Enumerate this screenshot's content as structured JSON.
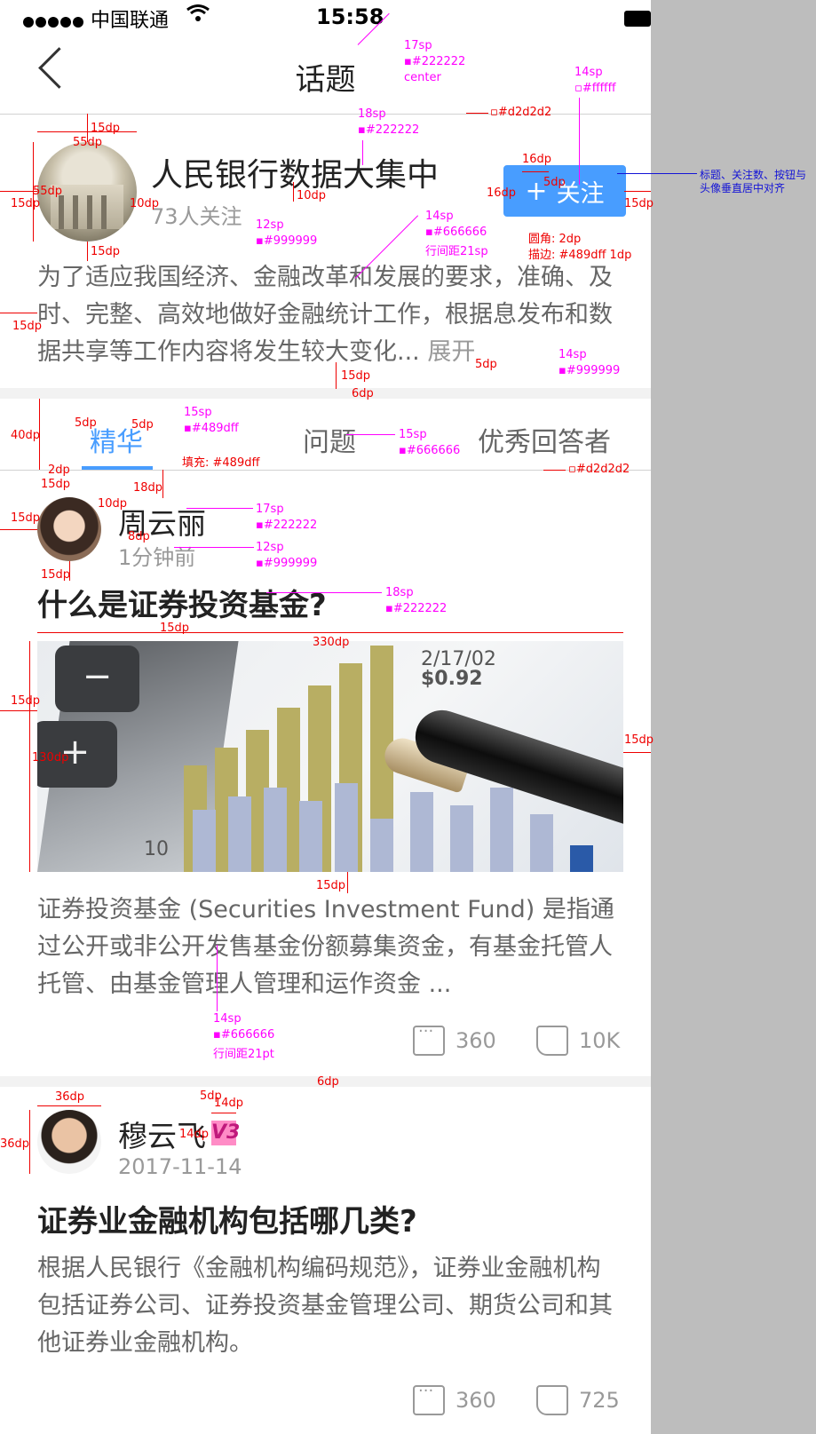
{
  "status_bar": {
    "carrier": "中国联通",
    "time": "15:58"
  },
  "nav": {
    "title": "话题"
  },
  "topic": {
    "title": "人民银行数据大集中",
    "follows": "73人关注",
    "follow_button": "关注",
    "description": "为了适应我国经济、金融改革和发展的要求，准确、及时、完整、高效地做好金融统计工作，根据息发布和数据共享等工作内容将发生较大变化...",
    "expand_label": "展开"
  },
  "tabs": [
    {
      "label": "精华",
      "active": true
    },
    {
      "label": "问题"
    },
    {
      "label": "优秀回答者"
    }
  ],
  "posts": [
    {
      "author": "周云丽",
      "time": "1分钟前",
      "title": "什么是证券投资基金?",
      "image_text": [
        "2/17/02",
        "$0.92",
        "10"
      ],
      "body": "证券投资基金 (Securities Investment Fund) 是指通过公开或非公开发售基金份额募集资金，有基金托管人托管、由基金管理人管理和运作资金 ...",
      "comments": "360",
      "likes": "10K"
    },
    {
      "author": "穆云飞",
      "badge": "V3",
      "time": "2017-11-14",
      "title": "证券业金融机构包括哪几类?",
      "body": "根据人民银行《金融机构编码规范》，证券业金融机构包括证券公司、证券投资基金管理公司、期货公司和其他证券业金融机构。",
      "comments": "360",
      "likes": "725"
    }
  ],
  "annotations": {
    "nav_title": [
      "17sp",
      "#222222",
      "center"
    ],
    "divider": "#d2d2d2",
    "topic_title": [
      "18sp",
      "#222222"
    ],
    "follow_text": [
      "14sp",
      "#ffffff"
    ],
    "align_note": "标题、关注数、按钮与头像垂直居中对齐",
    "follows": [
      "12sp",
      "#999999"
    ],
    "desc": [
      "14sp",
      "#666666",
      "行间距21sp"
    ],
    "button_radius": "圆角: 2dp",
    "button_stroke": "描边: #489dff 1dp",
    "expand": [
      "14sp",
      "#999999"
    ],
    "tab_active": [
      "15sp",
      "#489dff"
    ],
    "tab_inactive": [
      "15sp",
      "#666666"
    ],
    "tab_fill": "填充: #489dff",
    "divider2": "#d2d2d2",
    "author": [
      "17sp",
      "#222222"
    ],
    "time": [
      "12sp",
      "#999999"
    ],
    "question": [
      "18sp",
      "#222222"
    ],
    "body": [
      "14sp",
      "#666666",
      "行间距21pt"
    ],
    "dims": {
      "d15": "15dp",
      "d55": "55dp",
      "d10": "10dp",
      "d16": "16dp",
      "d5": "5dp",
      "d6": "6dp",
      "d40": "40dp",
      "d2": "2dp",
      "d18": "18dp",
      "d8": "8dp",
      "d330": "330dp",
      "d130": "130dp",
      "d36": "36dp",
      "d14": "14dp"
    }
  },
  "colors": {
    "accent": "#489dff",
    "title": "#222222",
    "body": "#666666",
    "muted": "#999999",
    "divider": "#d2d2d2",
    "annotation": "#ff00ff"
  }
}
